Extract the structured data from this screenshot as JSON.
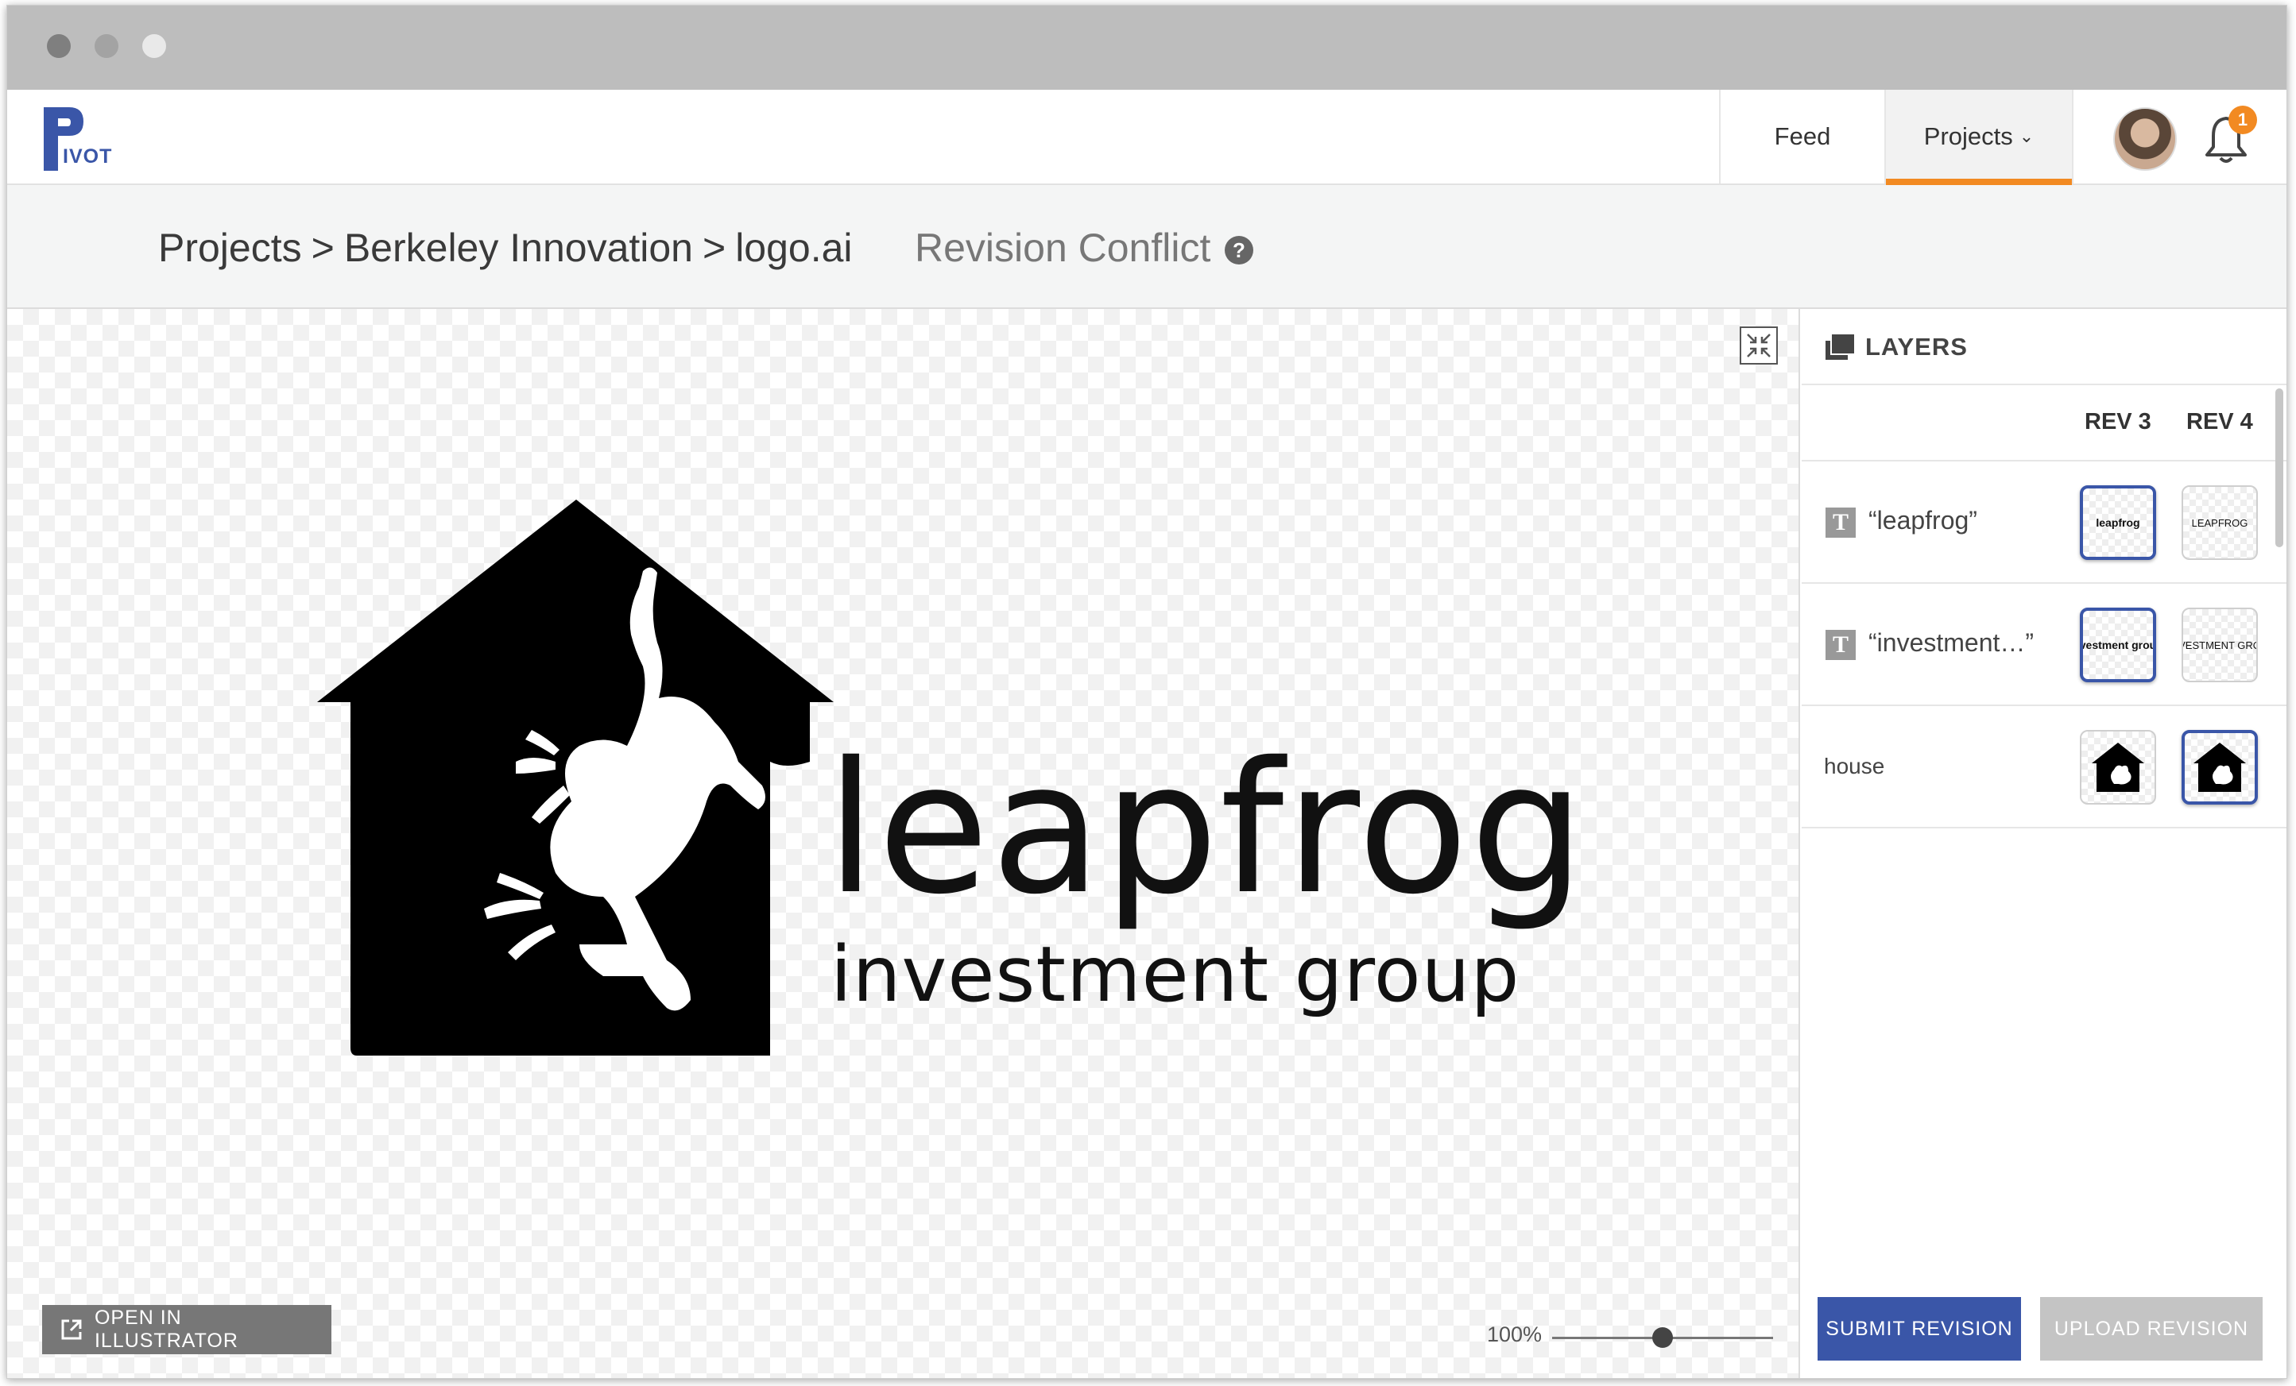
{
  "app": {
    "logo_text": "IVOT"
  },
  "nav": {
    "feed_label": "Feed",
    "projects_label": "Projects",
    "notification_count": "1",
    "accent_color": "#f28a22"
  },
  "breadcrumb": {
    "items": [
      "Projects",
      "Berkeley Innovation",
      "logo.ai"
    ],
    "separator": ">",
    "status": "Revision Conflict",
    "help_glyph": "?"
  },
  "artwork": {
    "wordmark": "leapfrog",
    "tagline": "investment group"
  },
  "canvas": {
    "open_button_label": "OPEN IN ILLUSTRATOR",
    "zoom_label": "100%",
    "zoom_level": 0.5
  },
  "layers": {
    "title": "LAYERS",
    "rev3_label": "REV 3",
    "rev4_label": "REV 4",
    "rows": [
      {
        "name": "“leapfrog”",
        "rev3_thumb": "leapfrog",
        "rev4_thumb": "LEAPFROG",
        "selected": "rev3"
      },
      {
        "name": "“investment…”",
        "rev3_thumb": "vestment grou",
        "rev4_thumb": "VESTMENT GRO",
        "selected": "rev3"
      },
      {
        "name": "house",
        "selected": "rev4"
      }
    ]
  },
  "actions": {
    "submit_label": "SUBMIT REVISION",
    "upload_label": "UPLOAD REVISION",
    "primary_color": "#3a56a8"
  }
}
